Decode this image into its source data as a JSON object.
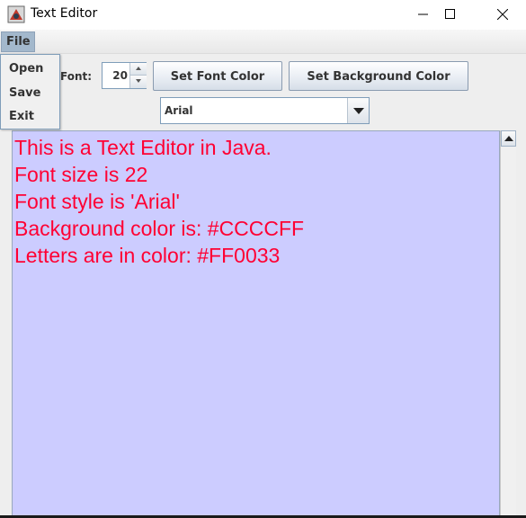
{
  "window": {
    "title": "Text Editor",
    "icons": {
      "app": "java-app-icon",
      "minimize": "minimize-icon",
      "maximize": "maximize-icon",
      "close": "close-icon"
    }
  },
  "menubar": {
    "file_label": "File"
  },
  "file_menu": {
    "items": [
      "Open",
      "Save",
      "Exit"
    ]
  },
  "toolbar": {
    "font_label": "Font:",
    "font_size_value": "20",
    "set_font_color_label": "Set Font Color",
    "set_background_color_label": "Set Background Color",
    "font_family_selected": "Arial"
  },
  "editor": {
    "lines": [
      "This is a Text Editor in Java.",
      "Font size is 22",
      "Font style is 'Arial'",
      "Background color is: #CCCCFF",
      "Letters are in color: #FF0033"
    ],
    "background_color": "#CCCCFF",
    "text_color": "#FF0033"
  }
}
